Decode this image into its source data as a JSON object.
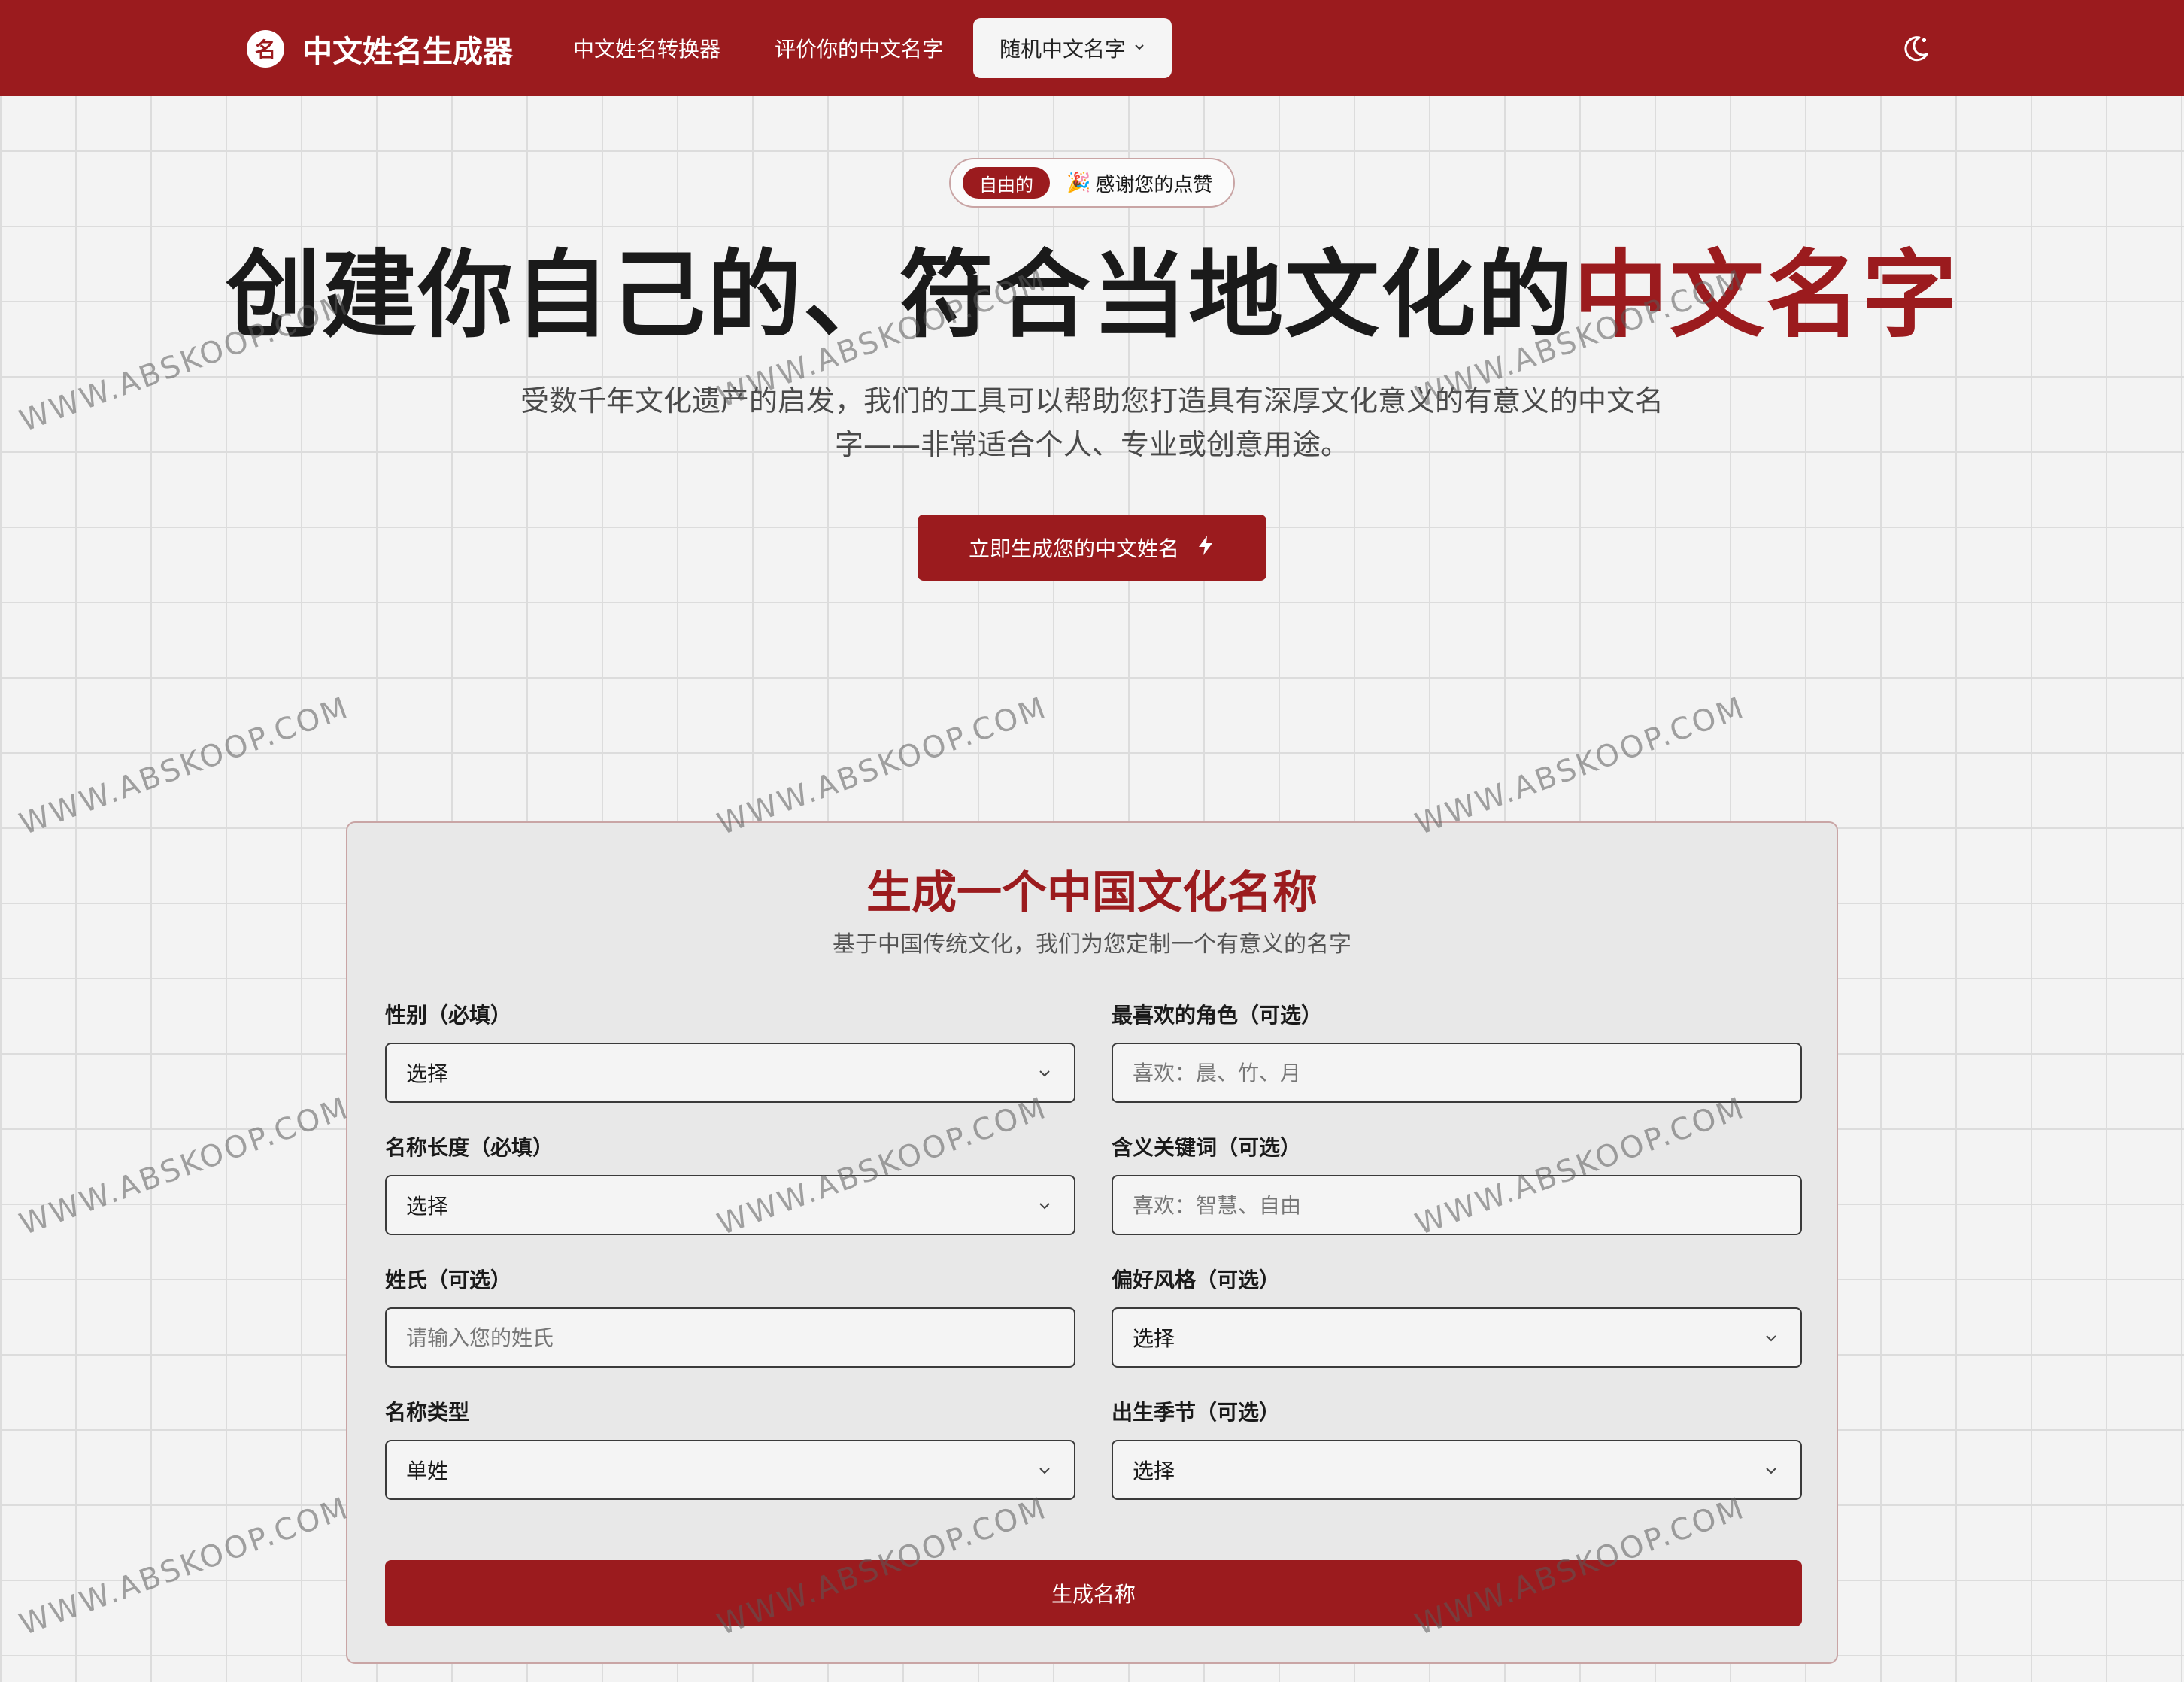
{
  "nav": {
    "brand_name": "中文姓名生成器",
    "logo_glyph": "名",
    "links": [
      "中文姓名转换器",
      "评价你的中文名字"
    ],
    "dropdown_label": "随机中文名字",
    "accent_color": "#9b1b1e"
  },
  "hero": {
    "badge_pill": "自由的",
    "badge_text": "感谢您的点赞",
    "title_main": "创建你自己的、符合当地文化的",
    "title_accent": "中文名字",
    "subtitle": "受数千年文化遗产的启发，我们的工具可以帮助您打造具有深厚文化意义的有意义的中文名字——非常适合个人、专业或创意用途。",
    "cta_label": "立即生成您的中文姓名"
  },
  "form": {
    "title": "生成一个中国文化名称",
    "subtitle": "基于中国传统文化，我们为您定制一个有意义的名字",
    "fields": {
      "gender": {
        "label": "性别（必填）",
        "value": "选择"
      },
      "favorite_role": {
        "label": "最喜欢的角色（可选）",
        "placeholder": "喜欢：晨、竹、月"
      },
      "name_length": {
        "label": "名称长度（必填）",
        "value": "选择"
      },
      "meaning_keywords": {
        "label": "含义关键词（可选）",
        "placeholder": "喜欢：智慧、自由"
      },
      "surname": {
        "label": "姓氏（可选）",
        "placeholder": "请输入您的姓氏"
      },
      "style": {
        "label": "偏好风格（可选）",
        "value": "选择"
      },
      "name_type": {
        "label": "名称类型",
        "value": "单姓"
      },
      "birth_season": {
        "label": "出生季节（可选）",
        "value": "选择"
      }
    },
    "submit_label": "生成名称"
  },
  "watermark_text": "WWW.ABSKOOP.COM"
}
